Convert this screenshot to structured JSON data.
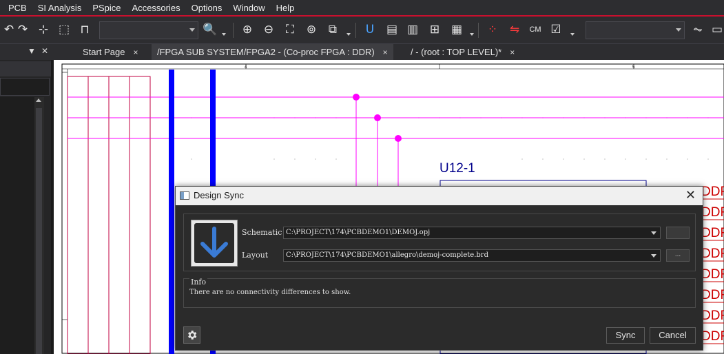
{
  "menu": [
    "PCB",
    "SI Analysis",
    "PSpice",
    "Accessories",
    "Options",
    "Window",
    "Help"
  ],
  "toolbar": {
    "icons": [
      "redo-icon",
      "select-icon",
      "area-select-icon",
      "net-icon",
      "search-icon",
      "zoom-in-icon",
      "zoom-out-icon",
      "zoom-area-icon",
      "zoom-fit-icon",
      "hierarchy-icon",
      "magnet-icon",
      "properties-icon",
      "netlist-icon",
      "tree-icon",
      "report-icon",
      "pcb-place-icon",
      "pcb-route-icon",
      "cm-icon",
      "drc-icon",
      "waveform-icon"
    ]
  },
  "tabs": [
    {
      "label": "Start Page",
      "active": false
    },
    {
      "label": "/FPGA SUB SYSTEM/FPGA2 - (Co-proc FPGA : DDR)",
      "active": true
    },
    {
      "label": "/ - (root : TOP LEVEL)*",
      "active": false
    }
  ],
  "tab_close_glyph": "×",
  "schematic": {
    "ruler_marks": [
      "4",
      "5"
    ],
    "part_ref": "U12-1",
    "ddr_labels": [
      "DDR",
      "DDR",
      "DDR",
      "DDR",
      "DDR",
      "DDR",
      "DDR",
      "DDR",
      "DDR"
    ],
    "colors": {
      "wire": "#ff00ff",
      "bus": "#0000ff",
      "ref": "#00008b",
      "net": "#cc0000"
    }
  },
  "dialog": {
    "title": "Design Sync",
    "schematic_label": "Schematic",
    "schematic_path": "C:\\PROJECT\\174\\PCBDEMO1\\DEMOJ.opj",
    "layout_label": "Layout",
    "layout_path": "C:\\PROJECT\\174\\PCBDEMO1\\allegro\\demoj-complete.brd",
    "browse_label": "...",
    "info_label": "Info",
    "info_text": "There are no connectivity differences to show.",
    "sync_label": "Sync",
    "cancel_label": "Cancel",
    "accent": "#3a7bd5"
  }
}
